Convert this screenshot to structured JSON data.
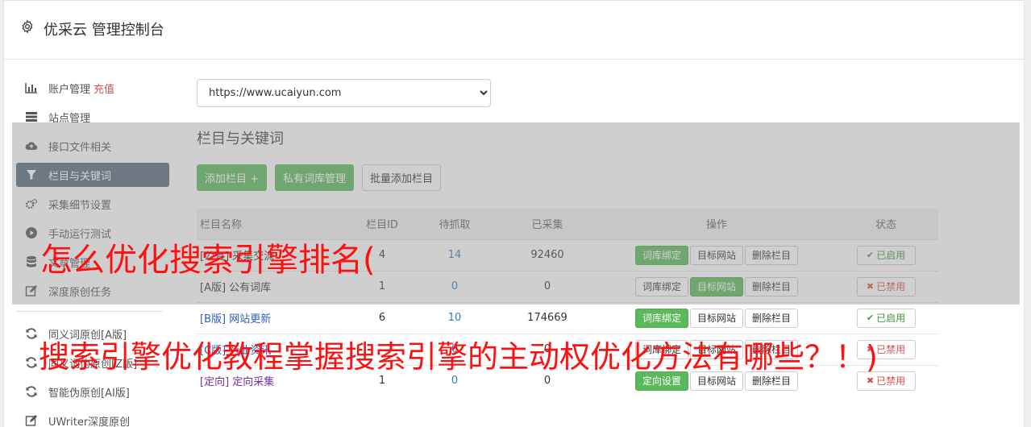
{
  "header": {
    "title": "优采云 管理控制台"
  },
  "sidebar": {
    "items": [
      {
        "label": "账户管理",
        "extra": "充值",
        "icon": "bar-chart-icon"
      },
      {
        "label": "站点管理",
        "icon": "server-icon"
      },
      {
        "label": "接口文件相关",
        "icon": "cloud-upload-icon"
      },
      {
        "label": "栏目与关键词",
        "icon": "filter-icon",
        "active": true
      },
      {
        "label": "采集细节设置",
        "icon": "cogs-icon"
      },
      {
        "label": "手动运行测试",
        "icon": "play-circle-icon"
      },
      {
        "label": "文章管理",
        "icon": "database-icon"
      },
      {
        "label": "深度原创任务",
        "icon": "edit-icon"
      }
    ],
    "items2": [
      {
        "label": "同义词原创[A版]",
        "icon": "refresh-icon"
      },
      {
        "label": "同义词伪原创[Z版]",
        "icon": "refresh-icon"
      },
      {
        "label": "智能伪原创[AI版]",
        "icon": "refresh-icon"
      },
      {
        "label": "UWriter深度原创",
        "icon": "edit-icon"
      }
    ]
  },
  "main": {
    "site_select": "https://www.ucaiyun.com",
    "section_title": "栏目与关键词",
    "buttons": {
      "add": "添加栏目 +",
      "private_lib": "私有词库管理",
      "batch_add": "批量添加栏目"
    },
    "table": {
      "headers": [
        "栏目名称",
        "栏目ID",
        "待抓取",
        "已采集",
        "操作",
        "状态"
      ],
      "rows": [
        {
          "name": "[公有] 采集交流",
          "id": "4",
          "pending": "14",
          "collected": "92460",
          "op1": "词库绑定",
          "op1_green": true,
          "op2": "目标网站",
          "op2_green": false,
          "op3": "删除栏目",
          "status": "已启用",
          "on": true
        },
        {
          "name": "[A版] 公有词库",
          "id": "1",
          "pending": "0",
          "collected": "0",
          "op1": "词库绑定",
          "op1_green": false,
          "op2": "目标网站",
          "op2_green": true,
          "op3": "删除栏目",
          "status": "已禁用",
          "on": false
        },
        {
          "name": "[B版] 网站更新",
          "id": "6",
          "pending": "10",
          "collected": "174669",
          "op1": "词库绑定",
          "op1_green": true,
          "op2": "目标网站",
          "op2_green": false,
          "op3": "删除栏目",
          "status": "已启用",
          "on": true
        },
        {
          "name": "[C版] 行业资讯",
          "id": "",
          "pending": "0",
          "collected": "0",
          "op1": "词库绑定",
          "op1_green": false,
          "op2": "目标网站",
          "op2_green": false,
          "op3": "删除栏目",
          "status": "已禁用",
          "on": false
        },
        {
          "name": "[定向] 定向采集",
          "id": "1",
          "pending": "0",
          "collected": "0",
          "op1": "定向设置",
          "op1_green": true,
          "op2": "目标网站",
          "op2_green": false,
          "op3": "删除栏目",
          "status": "已禁用",
          "on": false
        }
      ]
    }
  },
  "overlay_text": {
    "line1": "怎么优化搜索引擎排名(",
    "line2": "搜索引擎优化教程掌握搜索引擎的主动权优化方法有哪些？！)"
  },
  "colors": {
    "accent_green": "#5cb85c",
    "active_nav": "#596a7d",
    "overlay_text": "#ff1010",
    "danger": "#d9534f"
  }
}
